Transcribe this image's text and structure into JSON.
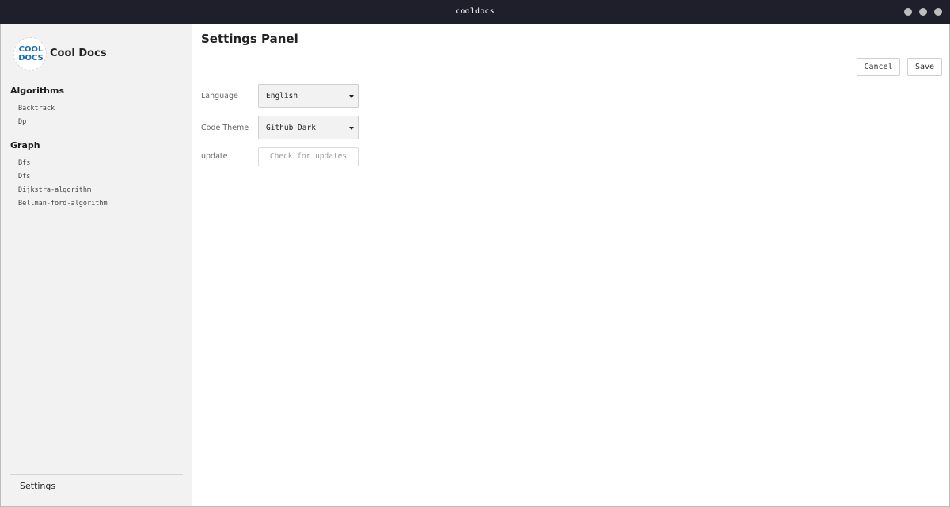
{
  "window": {
    "title": "cooldocs"
  },
  "sidebar": {
    "logo": {
      "line1": "COOL",
      "line2": "DOCS"
    },
    "brand": "Cool Docs",
    "categories": [
      {
        "name": "Algorithms",
        "items": [
          "Backtrack",
          "Dp"
        ]
      },
      {
        "name": "Graph",
        "items": [
          "Bfs",
          "Dfs",
          "Dijkstra-algorithm",
          "Bellman-ford-algorithm"
        ]
      }
    ],
    "settings_label": "Settings"
  },
  "main": {
    "title": "Settings Panel",
    "actions": {
      "cancel": "Cancel",
      "save": "Save"
    },
    "fields": {
      "language": {
        "label": "Language",
        "value": "English"
      },
      "code_theme": {
        "label": "Code Theme",
        "value": "Github Dark"
      },
      "update": {
        "label": "update",
        "button": "Check for updates"
      }
    }
  },
  "colors": {
    "titlebar": "#1e1f2b",
    "sidebar": "#f2f2f2",
    "logo_text": "#1d6fb8"
  },
  "icons": {
    "window_controls": [
      "minimize-icon",
      "maximize-icon",
      "close-icon"
    ],
    "dropdown": "chevron-down-icon"
  }
}
